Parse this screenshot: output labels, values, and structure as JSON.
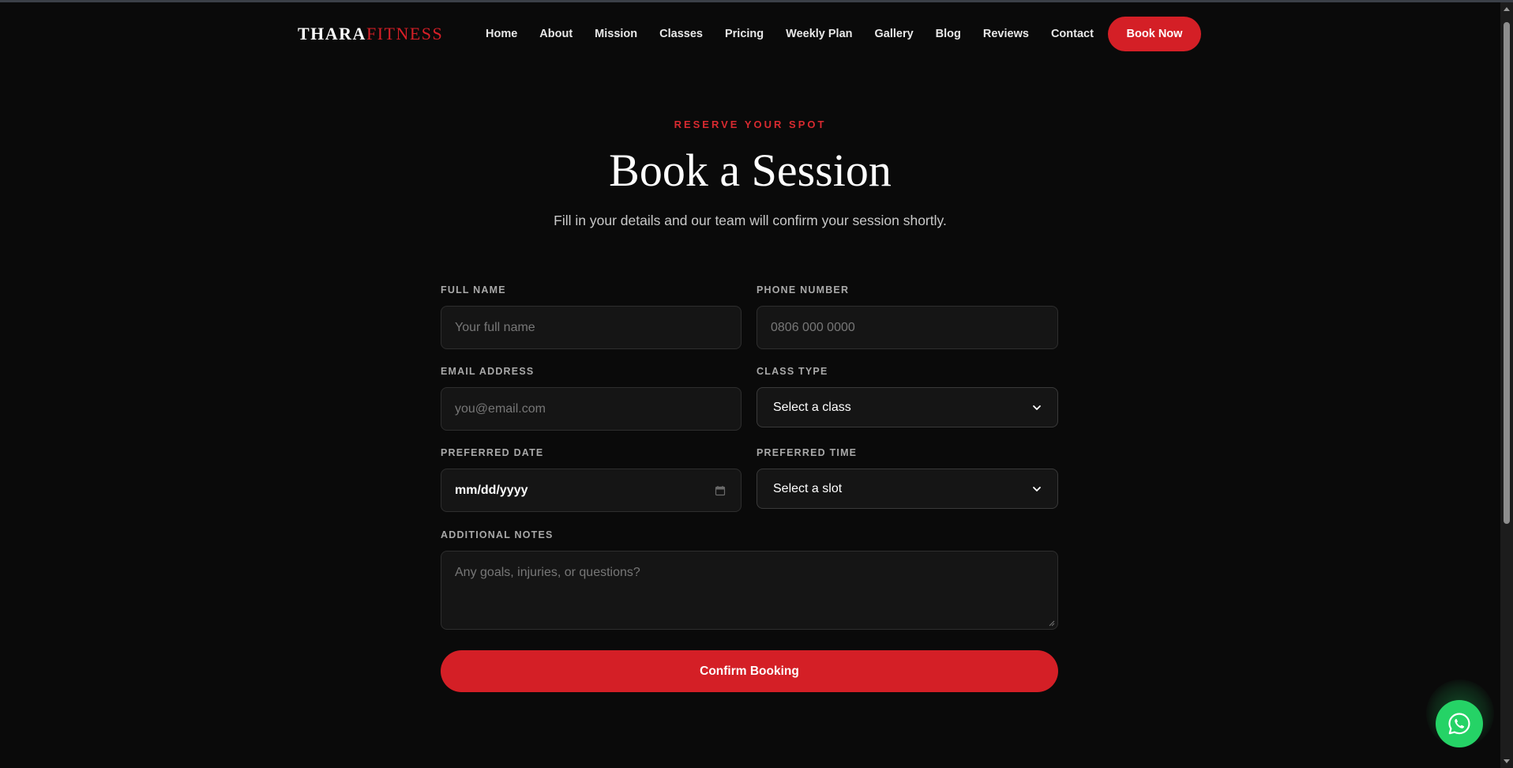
{
  "brand": {
    "logo_primary": "THARA",
    "logo_accent": "FITNESS"
  },
  "nav": {
    "links": [
      "Home",
      "About",
      "Mission",
      "Classes",
      "Pricing",
      "Weekly Plan",
      "Gallery",
      "Blog",
      "Reviews",
      "Contact"
    ],
    "cta_label": "Book Now"
  },
  "hero": {
    "eyebrow": "RESERVE YOUR SPOT",
    "title": "Book a Session",
    "subtitle": "Fill in your details and our team will confirm your session shortly."
  },
  "form": {
    "full_name": {
      "label": "FULL NAME",
      "placeholder": "Your full name"
    },
    "phone": {
      "label": "PHONE NUMBER",
      "placeholder": "0806 000 0000"
    },
    "email": {
      "label": "EMAIL ADDRESS",
      "placeholder": "you@email.com"
    },
    "class_type": {
      "label": "CLASS TYPE",
      "selected": "Select a class"
    },
    "date": {
      "label": "PREFERRED DATE",
      "value": "mm/dd/yyyy"
    },
    "time": {
      "label": "PREFERRED TIME",
      "selected": "Select a slot"
    },
    "notes": {
      "label": "ADDITIONAL NOTES",
      "placeholder": "Any goals, injuries, or questions?"
    },
    "submit_label": "Confirm Booking"
  },
  "colors": {
    "background": "#0a0a0a",
    "accent": "#d41f26",
    "whatsapp": "#25d366"
  },
  "icons": {
    "whatsapp": "whatsapp-icon",
    "calendar": "calendar-icon",
    "chevron": "chevron-down-icon"
  }
}
